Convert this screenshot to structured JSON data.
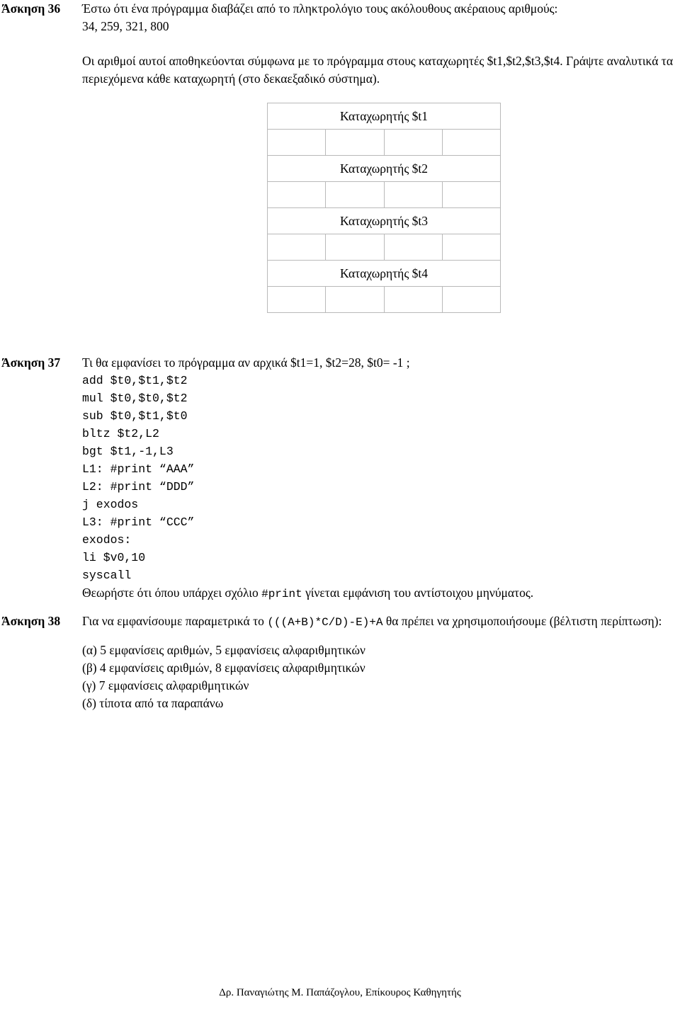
{
  "document": {
    "footer": "Δρ. Παναγιώτης Μ. Παπάζογλου, Επίκουρος Καθηγητής"
  },
  "exercise36": {
    "label": "Άσκηση 36",
    "intro": "Έστω ότι ένα πρόγραμμα διαβάζει από το πληκτρολόγιο τους ακόλουθους ακέραιους αριθμούς:",
    "numbers": "34, 259, 321, 800",
    "body": "Οι αριθμοί αυτοί αποθηκεύονται σύμφωνα με το πρόγραμμα στους καταχωρητές $t1,$t2,$t3,$t4. Γράψτε αναλυτικά τα περιεχόμενα κάθε καταχωρητή (στο δεκαεξαδικό σύστημα).",
    "table": {
      "columns": 4,
      "rows": [
        {
          "header": "Καταχωρητής $t1",
          "cells": [
            "",
            "",
            "",
            ""
          ]
        },
        {
          "header": "Καταχωρητής $t2",
          "cells": [
            "",
            "",
            "",
            ""
          ]
        },
        {
          "header": "Καταχωρητής $t3",
          "cells": [
            "",
            "",
            "",
            ""
          ]
        },
        {
          "header": "Καταχωρητής $t4",
          "cells": [
            "",
            "",
            "",
            ""
          ]
        }
      ]
    }
  },
  "exercise37": {
    "label": "Άσκηση 37",
    "question": "Τι θα εμφανίσει το πρόγραμμα αν αρχικά $t1=1, $t2=28, $t0= -1 ;",
    "code": "add $t0,$t1,$t2\nmul $t0,$t0,$t2\nsub $t0,$t1,$t0\nbltz $t2,L2\nbgt $t1,-1,L3\nL1: #print “AAA”\nL2: #print “DDD”\nj exodos\nL3: #print “CCC”\nexodos:\nli $v0,10\nsyscall",
    "note_before": "Θεωρήστε ότι όπου υπάρχει σχόλιο ",
    "note_mono": "#print",
    "note_after": " γίνεται εμφάνιση του αντίστοιχου μηνύματος."
  },
  "exercise38": {
    "label": "Άσκηση 38",
    "prompt_before": "Για να εμφανίσουμε παραμετρικά το ",
    "expression": "(((A+B)*C/D)-E)+A",
    "prompt_after": " θα πρέπει να χρησιμοποιήσουμε (βέλτιστη περίπτωση):",
    "choices": [
      "(α) 5 εμφανίσεις αριθμών, 5 εμφανίσεις αλφαριθμητικών",
      "(β) 4 εμφανίσεις αριθμών, 8 εμφανίσεις αλφαριθμητικών",
      "(γ) 7 εμφανίσεις αλφαριθμητικών",
      "(δ) τίποτα από τα παραπάνω"
    ]
  }
}
